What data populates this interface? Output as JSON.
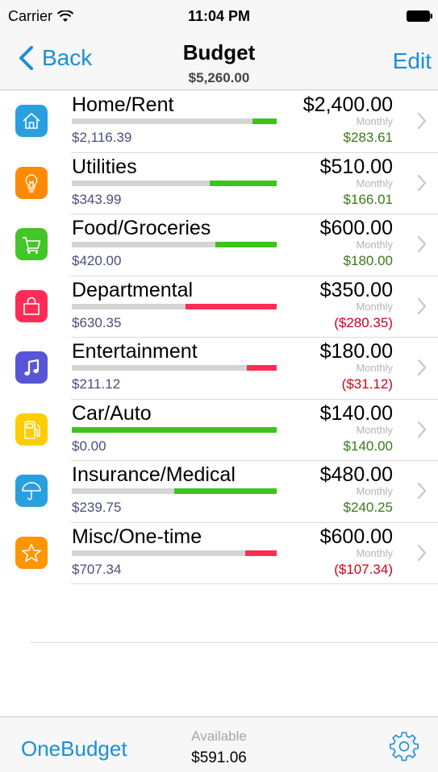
{
  "status_bar": {
    "carrier": "Carrier",
    "time": "11:04 PM"
  },
  "nav": {
    "back_label": "Back",
    "title": "Budget",
    "subtitle": "$5,260.00",
    "edit_label": "Edit"
  },
  "categories": [
    {
      "name": "Home/Rent",
      "icon": "home-icon",
      "color": "#2a9fe0",
      "spent": "$2,116.39",
      "budget": "$2,400.00",
      "period": "Monthly",
      "remaining": "$283.61",
      "status": "under",
      "spent_fraction": 0.882
    },
    {
      "name": "Utilities",
      "icon": "lightbulb-icon",
      "color": "#ff8a00",
      "spent": "$343.99",
      "budget": "$510.00",
      "period": "Monthly",
      "remaining": "$166.01",
      "status": "under",
      "spent_fraction": 0.674
    },
    {
      "name": "Food/Groceries",
      "icon": "cart-icon",
      "color": "#44c52a",
      "spent": "$420.00",
      "budget": "$600.00",
      "period": "Monthly",
      "remaining": "$180.00",
      "status": "under",
      "spent_fraction": 0.7
    },
    {
      "name": "Departmental",
      "icon": "shopping-bag-icon",
      "color": "#ff2d55",
      "spent": "$630.35",
      "budget": "$350.00",
      "period": "Monthly",
      "remaining": "($280.35)",
      "status": "over",
      "spent_fraction": 1.8
    },
    {
      "name": "Entertainment",
      "icon": "music-note-icon",
      "color": "#5856d6",
      "spent": "$211.12",
      "budget": "$180.00",
      "period": "Monthly",
      "remaining": "($31.12)",
      "status": "over",
      "spent_fraction": 1.173
    },
    {
      "name": "Car/Auto",
      "icon": "fuel-pump-icon",
      "color": "#ffcc00",
      "spent": "$0.00",
      "budget": "$140.00",
      "period": "Monthly",
      "remaining": "$140.00",
      "status": "under",
      "spent_fraction": 0.0
    },
    {
      "name": "Insurance/Medical",
      "icon": "umbrella-icon",
      "color": "#2a9fe0",
      "spent": "$239.75",
      "budget": "$480.00",
      "period": "Monthly",
      "remaining": "$240.25",
      "status": "under",
      "spent_fraction": 0.5
    },
    {
      "name": "Misc/One-time",
      "icon": "star-icon",
      "color": "#ff9500",
      "spent": "$707.34",
      "budget": "$600.00",
      "period": "Monthly",
      "remaining": "($107.34)",
      "status": "over",
      "spent_fraction": 1.179
    }
  ],
  "colors": {
    "accent": "#1a8fd6",
    "under_bar": "#3cc41c",
    "over_bar": "#ff2d55",
    "track": "#d4d4d4"
  },
  "toolbar": {
    "brand": "OneBudget",
    "available_label": "Available",
    "available_value": "$591.06",
    "settings_icon": "gear-icon"
  }
}
